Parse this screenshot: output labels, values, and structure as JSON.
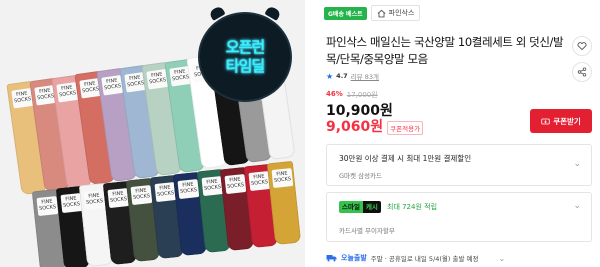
{
  "image": {
    "timer_line1": "오픈런",
    "timer_line2": "타임딜",
    "sock_brand": "FINE SOCKS",
    "colors": {
      "top_row": [
        "#e8c07c",
        "#d98a7e",
        "#e9a3a2",
        "#d46e63",
        "#b8a0c4",
        "#9fb7d2",
        "#b7d2c2",
        "#8fcfb8",
        "#ffffff",
        "#151515",
        "#9a9a9a",
        "#f4f4f4"
      ],
      "bottom_row": [
        "#8c8c8c",
        "#161616",
        "#f5f5f5",
        "#1e1e1e",
        "#44513e",
        "#2a3f54",
        "#1b2f5e",
        "#2a6b52",
        "#7a1f2a",
        "#c41f32",
        "#d4a436"
      ]
    }
  },
  "badges": {
    "best": "G배송 베스트"
  },
  "seller": {
    "name": "파인삭스"
  },
  "product": {
    "title": "파인삭스 매일신는 국산양말 10켤레세트 외 덧신/발목/단목/중목양말 모음"
  },
  "rating": {
    "score": "4.7",
    "reviews": "리뷰 83개"
  },
  "price": {
    "discount": "46%",
    "original": "17,000원",
    "sale": "10,900원",
    "coupon_price": "9,060원",
    "coupon_note": "쿠폰적용가",
    "coupon_button": "쿠폰받기"
  },
  "benefit_card": {
    "line1": "30만원 이상 결제 시 최대 1만원 결제할인",
    "line2": "G마켓 삼성카드"
  },
  "smile_card": {
    "badge_a": "스마일",
    "badge_b": "캐시",
    "points": "최대 724원 적립",
    "note": "카드사별 무이자할부"
  },
  "delivery": {
    "label": "오늘출발",
    "text": "주말 · 공휴일로 내일 5/4(월) 출발 예정"
  }
}
